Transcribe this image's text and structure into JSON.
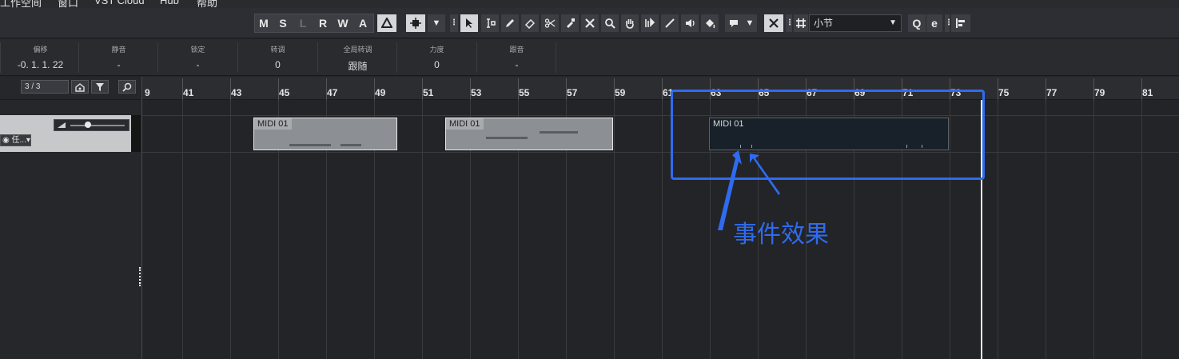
{
  "menu": [
    "工作空间",
    "窗口",
    "VST Cloud",
    "Hub",
    "帮助"
  ],
  "toolbar": {
    "track_states": [
      "M",
      "S",
      "L",
      "R",
      "W",
      "A"
    ],
    "grid_type": "小节",
    "q_label": "Q",
    "e_label": "e"
  },
  "info": [
    {
      "label": "偏移",
      "value": "-0. 1. 1. 22"
    },
    {
      "label": "静音",
      "value": "-"
    },
    {
      "label": "锁定",
      "value": "-"
    },
    {
      "label": "转调",
      "value": "0"
    },
    {
      "label": "全局转调",
      "value": "跟随"
    },
    {
      "label": "力度",
      "value": "0"
    },
    {
      "label": "跟音",
      "value": "-"
    }
  ],
  "tracklist": {
    "counter": "3 / 3",
    "instrument": "任..."
  },
  "ruler": {
    "bars": [
      "9",
      "41",
      "43",
      "45",
      "47",
      "49",
      "51",
      "53",
      "55",
      "57",
      "59",
      "61",
      "63",
      "65",
      "67",
      "69",
      "71",
      "73",
      "75",
      "77",
      "79",
      "81"
    ]
  },
  "events": [
    {
      "name": "MIDI 01"
    },
    {
      "name": "MIDI 01"
    },
    {
      "name": "MIDI 01"
    }
  ],
  "annotation": {
    "label": "事件效果",
    "color": "#2f6bf0"
  }
}
